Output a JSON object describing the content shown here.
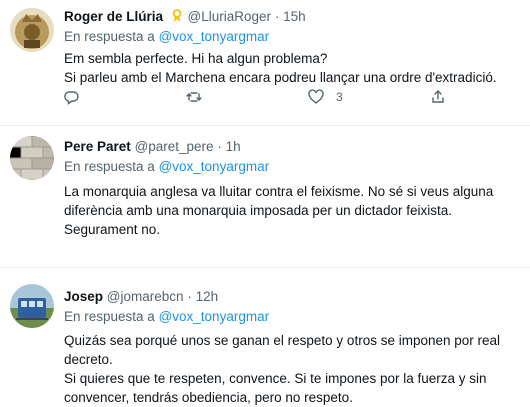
{
  "tweets": [
    {
      "name": "Roger de Llúria",
      "handle": "@LluriaRoger",
      "time": "15h",
      "reply_prefix": "En respuesta a",
      "reply_mention": "@vox_tonyargmar",
      "lines": [
        "Em sembla perfecte. Hi ha algun problema?",
        "Si parleu amb el Marchena encara podreu llançar una ordre d'extradició."
      ],
      "like_count": "3"
    },
    {
      "name": "Pere Paret",
      "handle": "@paret_pere",
      "time": "1h",
      "reply_prefix": "En respuesta a",
      "reply_mention": "@vox_tonyargmar",
      "lines": [
        "La monarquia anglesa va lluitar contra el feixisme. No sé si veus alguna",
        "diferència amb una monarquia imposada per un dictador feixista.",
        "Segurament no."
      ]
    },
    {
      "name": "Josep",
      "handle": "@jomarebcn",
      "time": "12h",
      "reply_prefix": "En respuesta a",
      "reply_mention": "@vox_tonyargmar",
      "lines": [
        "Quizás sea porqué unos se ganan el respeto y otros se imponen por real",
        "decreto.",
        "Si quieres que te respeten, convence. Si te impones por la fuerza y sin",
        "convencer, tendrás obediencia, pero no respeto."
      ]
    }
  ],
  "dot": "·",
  "colors": {
    "link": "#1b95e0",
    "secondary": "#536471",
    "text": "#0f1419",
    "divider": "#e6ecf0"
  }
}
